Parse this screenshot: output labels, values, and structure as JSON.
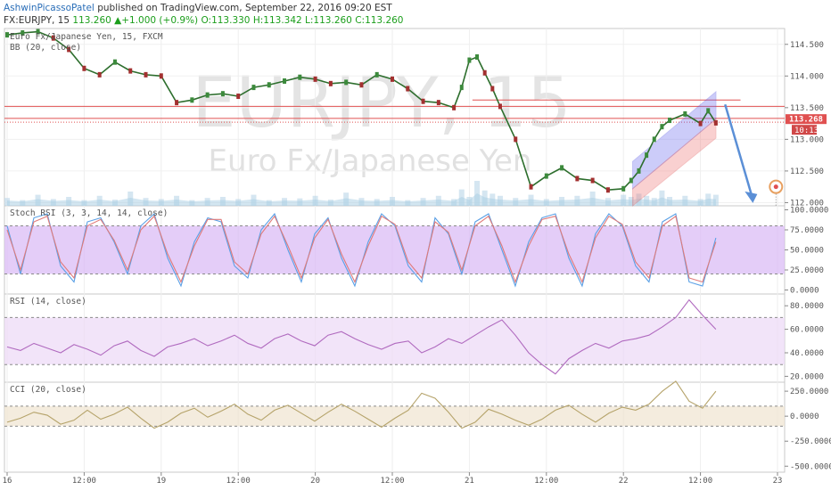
{
  "header": {
    "author": "AshwinPicassoPatel",
    "published_text": "published on TradingView.com, September 22, 2016 09:20 EST",
    "symbol": "FX:EURJPY, 15",
    "price": "113.260",
    "change": "+1.000 (+0.9%)",
    "o": "O:113.330",
    "h": "H:113.342",
    "l": "L:113.260",
    "c": "C:113.260"
  },
  "watermark": {
    "line1": "EURJPY, 15",
    "line2": "Euro Fx/Japanese Yen"
  },
  "chart_data": [
    {
      "type": "line",
      "title": "Euro Fx/Japanese Yen, 15, FXCM",
      "indicator_label": "BB (20, close)",
      "ylim": [
        111.95,
        114.75
      ],
      "y_ticks": [
        "114.500",
        "114.000",
        "113.500",
        "113.000",
        "112.500",
        "112.000"
      ],
      "price_label": "113.268",
      "timer_label": "10:13",
      "x_labels": [
        "16",
        "12:00",
        "19",
        "12:00",
        "20",
        "12:00",
        "21",
        "12:00",
        "22",
        "12:00",
        "23"
      ],
      "x_label_pos": [
        0,
        0.5,
        1,
        1.5,
        2,
        2.5,
        3,
        3.5,
        4,
        4.5,
        5
      ],
      "close_series": {
        "x": [
          0,
          0.1,
          0.2,
          0.3,
          0.4,
          0.5,
          0.6,
          0.7,
          0.8,
          0.9,
          1.0,
          1.1,
          1.2,
          1.3,
          1.4,
          1.5,
          1.6,
          1.7,
          1.8,
          1.9,
          2.0,
          2.1,
          2.2,
          2.3,
          2.4,
          2.5,
          2.6,
          2.7,
          2.8,
          2.9,
          2.95,
          3.0,
          3.05,
          3.1,
          3.15,
          3.2,
          3.3,
          3.4,
          3.5,
          3.6,
          3.7,
          3.8,
          3.9,
          4.0,
          4.05,
          4.1,
          4.15,
          4.2,
          4.25,
          4.3,
          4.4,
          4.5,
          4.55,
          4.6
        ],
        "y": [
          114.65,
          114.68,
          114.7,
          114.6,
          114.42,
          114.12,
          114.02,
          114.22,
          114.08,
          114.02,
          114.0,
          113.58,
          113.62,
          113.7,
          113.72,
          113.68,
          113.82,
          113.86,
          113.92,
          113.98,
          113.95,
          113.88,
          113.9,
          113.86,
          114.02,
          113.95,
          113.8,
          113.6,
          113.58,
          113.5,
          113.82,
          114.25,
          114.3,
          114.05,
          113.8,
          113.52,
          113.0,
          112.25,
          112.42,
          112.55,
          112.38,
          112.35,
          112.2,
          112.22,
          112.35,
          112.5,
          112.75,
          113.0,
          113.2,
          113.3,
          113.4,
          113.25,
          113.45,
          113.26
        ]
      },
      "hlines": [
        113.52,
        113.33,
        113.27
      ],
      "short_hline": 113.62,
      "channel": {
        "upper_start": [
          4.06,
          112.65
        ],
        "upper_end": [
          4.6,
          113.75
        ],
        "mid_start": [
          4.06,
          112.22
        ],
        "mid_end": [
          4.6,
          113.32
        ],
        "lower_start": [
          4.06,
          111.95
        ],
        "lower_end": [
          4.6,
          113.02
        ]
      },
      "forecast_arrow": {
        "from": [
          4.66,
          113.55
        ],
        "to": [
          4.84,
          112.05
        ]
      },
      "target_marker": [
        4.99,
        112.25
      ],
      "volume_relative": [
        0.2,
        0.1,
        0.35,
        0.15,
        0.25,
        0.1,
        0.3,
        0.12,
        0.5,
        0.2,
        0.15,
        0.3,
        0.1,
        0.2,
        0.25,
        0.15,
        0.35,
        0.1,
        0.2,
        0.18,
        0.3,
        0.12,
        0.45,
        0.2,
        0.15,
        0.25,
        0.1,
        0.2,
        0.3,
        0.15,
        0.6,
        0.25,
        1.0,
        0.55,
        0.4,
        0.3,
        0.2,
        0.35,
        0.15,
        0.25,
        0.3,
        0.5,
        0.2,
        0.35,
        0.25,
        0.4,
        0.3,
        0.2,
        0.55,
        0.25,
        0.3,
        0.15,
        0.4,
        0.35
      ]
    },
    {
      "type": "line",
      "title": "Stoch RSI (3, 3, 14, 14, close)",
      "ylim": [
        -5,
        105
      ],
      "y_ticks": [
        "100.0000",
        "75.0000",
        "50.0000",
        "25.0000",
        "0.0000"
      ],
      "y_tick_values": [
        100,
        75,
        50,
        25,
        0
      ],
      "band": [
        20,
        80
      ],
      "series": [
        {
          "color": "#5aa0e6",
          "values": [
            80,
            20,
            90,
            95,
            30,
            10,
            85,
            90,
            60,
            20,
            80,
            95,
            40,
            5,
            60,
            90,
            85,
            30,
            15,
            75,
            95,
            50,
            10,
            70,
            90,
            40,
            5,
            60,
            95,
            80,
            30,
            10,
            90,
            70,
            20,
            85,
            95,
            50,
            5,
            60,
            90,
            95,
            40,
            5,
            70,
            95,
            80,
            30,
            10,
            85,
            95,
            10,
            5,
            65
          ]
        },
        {
          "color": "#e07a7a",
          "values": [
            75,
            25,
            85,
            92,
            35,
            15,
            80,
            88,
            62,
            25,
            75,
            92,
            45,
            10,
            55,
            88,
            88,
            35,
            20,
            70,
            92,
            55,
            15,
            65,
            88,
            45,
            10,
            55,
            92,
            82,
            35,
            15,
            85,
            72,
            25,
            80,
            92,
            55,
            10,
            55,
            88,
            92,
            45,
            10,
            65,
            92,
            82,
            35,
            15,
            80,
            92,
            15,
            10,
            60
          ]
        }
      ]
    },
    {
      "type": "line",
      "title": "RSI (14, close)",
      "ylim": [
        15,
        90
      ],
      "y_ticks": [
        "80.0000",
        "60.0000",
        "40.0000",
        "20.0000"
      ],
      "y_tick_values": [
        80,
        60,
        40,
        20
      ],
      "band": [
        30,
        70
      ],
      "series": [
        {
          "color": "#b06abf",
          "values": [
            45,
            42,
            48,
            44,
            40,
            47,
            43,
            38,
            46,
            50,
            42,
            37,
            45,
            48,
            52,
            46,
            50,
            55,
            48,
            44,
            52,
            56,
            50,
            46,
            55,
            58,
            52,
            47,
            43,
            48,
            50,
            40,
            45,
            52,
            48,
            55,
            62,
            68,
            55,
            40,
            30,
            22,
            35,
            42,
            48,
            44,
            50,
            52,
            55,
            62,
            70,
            85,
            72,
            60
          ]
        }
      ]
    },
    {
      "type": "line",
      "title": "CCI (20, close)",
      "ylim": [
        -560,
        340
      ],
      "y_ticks": [
        "250.0000",
        "0.0000",
        "-250.0000",
        "-500.0000"
      ],
      "y_tick_values": [
        250,
        0,
        -250,
        -500
      ],
      "band": [
        -100,
        100
      ],
      "series": [
        {
          "color": "#b5a36a",
          "values": [
            -60,
            -20,
            40,
            10,
            -80,
            -40,
            60,
            -30,
            20,
            90,
            -20,
            -120,
            -60,
            30,
            80,
            -10,
            50,
            120,
            20,
            -40,
            60,
            110,
            30,
            -50,
            40,
            120,
            50,
            -30,
            -110,
            -20,
            60,
            230,
            180,
            40,
            -120,
            -60,
            70,
            20,
            -40,
            -90,
            -30,
            60,
            110,
            20,
            -60,
            30,
            90,
            60,
            120,
            250,
            350,
            150,
            80,
            250
          ]
        }
      ]
    }
  ]
}
